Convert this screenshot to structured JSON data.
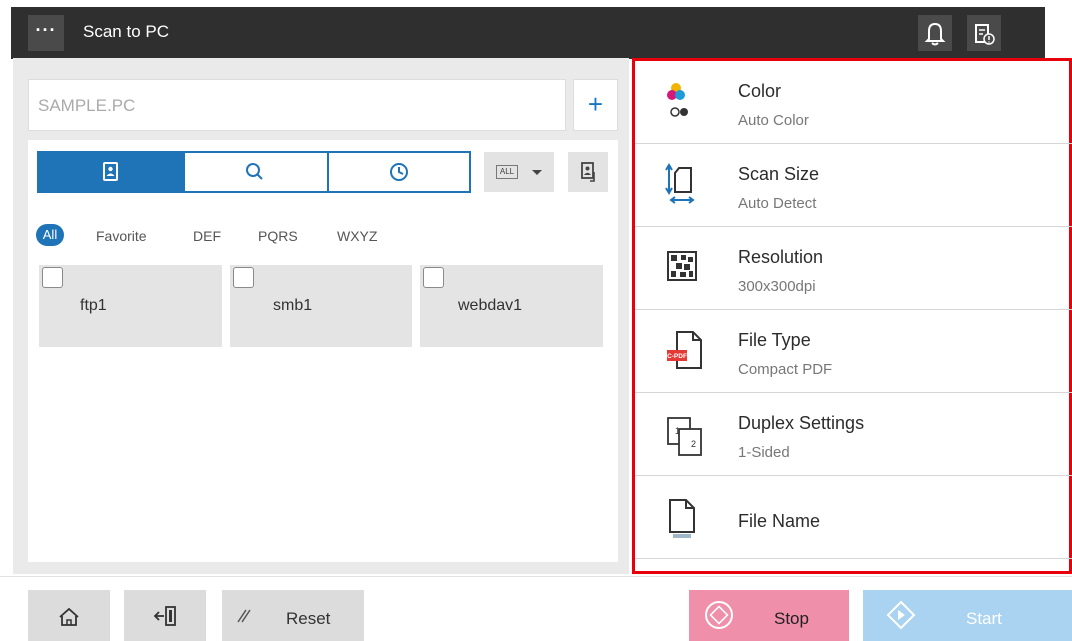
{
  "header": {
    "title": "Scan to PC",
    "menu_label": "···"
  },
  "destination": {
    "value": "SAMPLE.PC",
    "add_label": "+"
  },
  "view_tabs": [
    {
      "icon": "address-book-icon",
      "selected": true
    },
    {
      "icon": "search-icon",
      "selected": false
    },
    {
      "icon": "history-clock-icon",
      "selected": false
    }
  ],
  "index_select": {
    "value": "ALL"
  },
  "filters": {
    "items": [
      "All",
      "Favorite",
      "DEF",
      "PQRS",
      "WXYZ"
    ]
  },
  "destinations": [
    {
      "label": "ftp1",
      "checked": false
    },
    {
      "label": "smb1",
      "checked": false
    },
    {
      "label": "webdav1",
      "checked": false
    }
  ],
  "settings": [
    {
      "title": "Color",
      "value": "Auto Color",
      "icon": "color-icon"
    },
    {
      "title": "Scan Size",
      "value": "Auto Detect",
      "icon": "scan-size-icon"
    },
    {
      "title": "Resolution",
      "value": "300x300dpi",
      "icon": "resolution-icon"
    },
    {
      "title": "File Type",
      "value": "Compact PDF",
      "icon": "file-type-icon",
      "badge": "C-PDF"
    },
    {
      "title": "Duplex Settings",
      "value": "1-Sided",
      "icon": "duplex-icon"
    },
    {
      "title": "File Name",
      "value": "",
      "icon": "file-name-icon"
    }
  ],
  "footer": {
    "reset_label": "Reset",
    "stop_label": "Stop",
    "start_label": "Start"
  },
  "colors": {
    "accent": "#1f73b7",
    "highlight_border": "#e8000a",
    "stop": "#f08fa9",
    "start": "#a9d3f0",
    "topbar": "#2f2f2f"
  }
}
